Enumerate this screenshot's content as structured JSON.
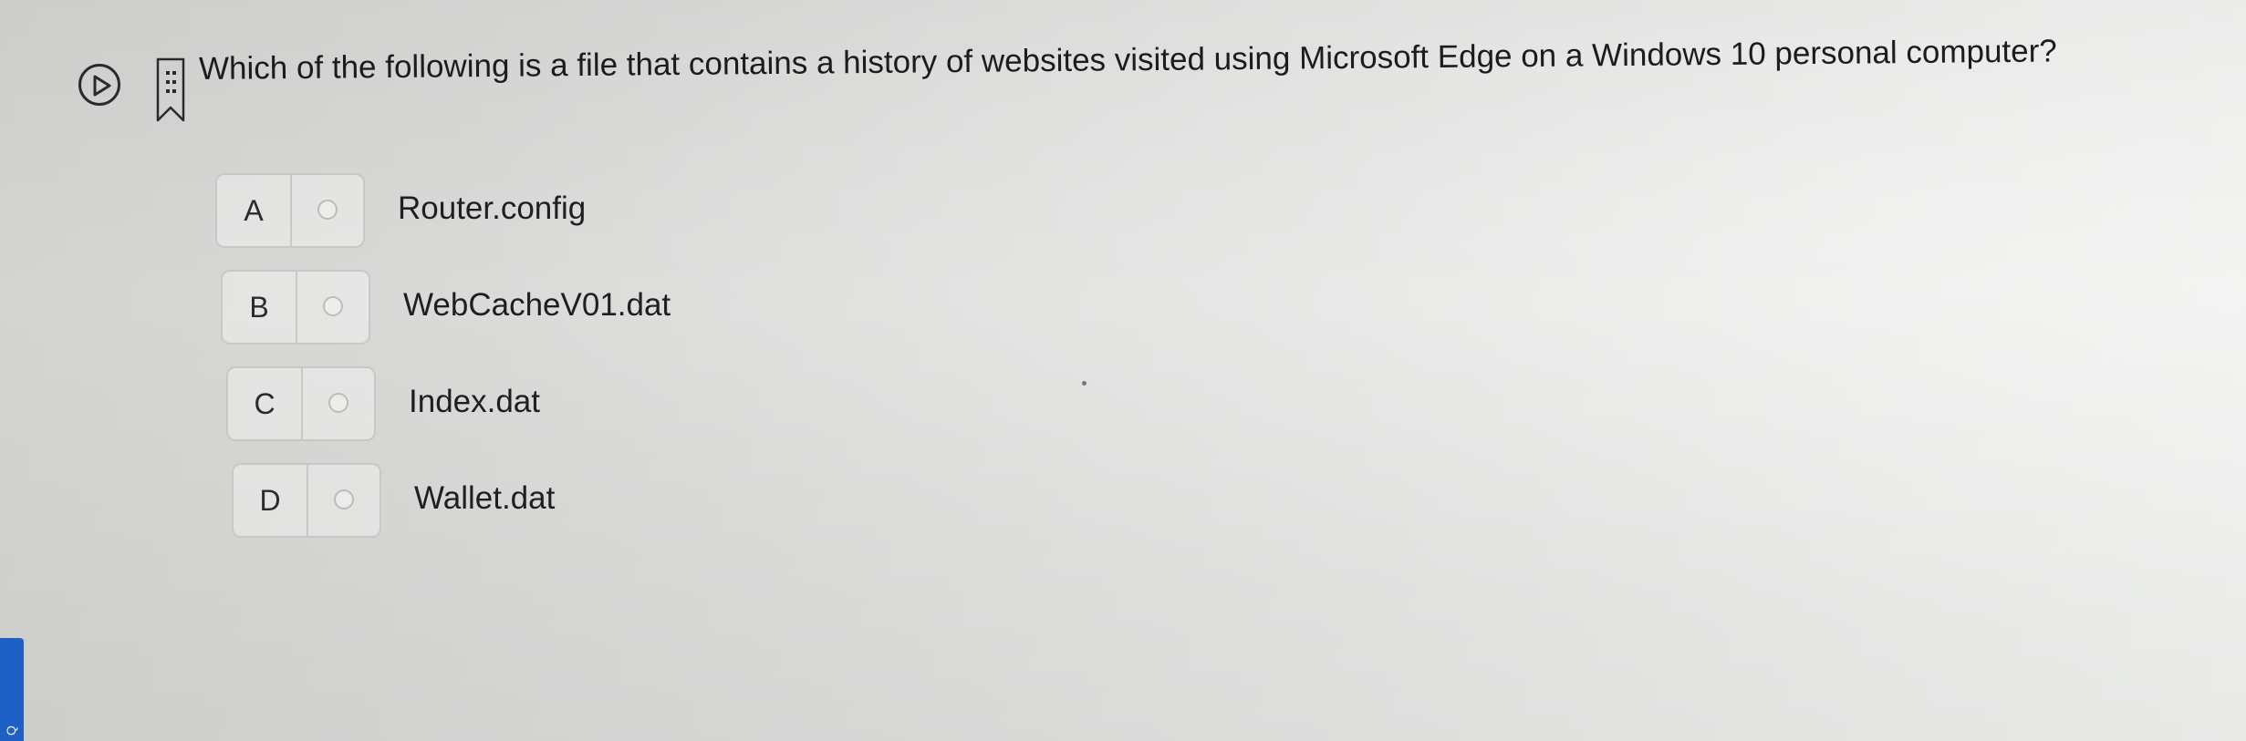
{
  "question": {
    "text": "Which of the following is a file that contains a history of websites visited using Microsoft Edge on a Windows 10 personal computer?"
  },
  "options": [
    {
      "letter": "A",
      "text": "Router.config"
    },
    {
      "letter": "B",
      "text": "WebCacheV01.dat"
    },
    {
      "letter": "C",
      "text": "Index.dat"
    },
    {
      "letter": "D",
      "text": "Wallet.dat"
    }
  ],
  "side_tab": {
    "label": "Q"
  },
  "colors": {
    "accent": "#1d5fc4",
    "text": "#1c1c1c",
    "border": "#c8c9c6"
  },
  "icons": {
    "play": "play-circle-icon",
    "bookmark": "bookmark-flag-icon"
  }
}
